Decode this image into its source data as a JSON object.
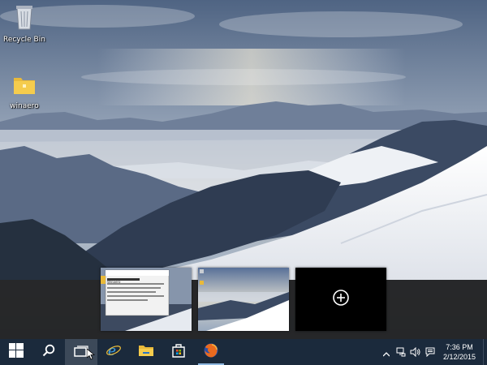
{
  "desktop": {
    "icons": [
      {
        "label": "Recycle Bin",
        "icon": "recycle-bin-icon"
      },
      {
        "label": "winaero",
        "icon": "folder-icon"
      }
    ]
  },
  "task_view": {
    "thumbnails": [
      {
        "name": "desktop-1",
        "window_title": "Winaero"
      },
      {
        "name": "desktop-2"
      }
    ],
    "new_desktop_icon": "plus-circle-icon"
  },
  "taskbar": {
    "buttons": [
      {
        "name": "start",
        "icon": "windows-logo-icon"
      },
      {
        "name": "search",
        "icon": "search-icon"
      },
      {
        "name": "task-view",
        "icon": "task-view-icon",
        "active": true
      },
      {
        "name": "internet-explorer",
        "icon": "internet-explorer-icon"
      },
      {
        "name": "file-explorer",
        "icon": "folder-icon"
      },
      {
        "name": "store",
        "icon": "store-icon"
      },
      {
        "name": "firefox",
        "icon": "firefox-icon",
        "running": true
      }
    ],
    "tray": {
      "icons": [
        "chevron-up-icon",
        "network-icon",
        "volume-icon",
        "action-center-icon"
      ],
      "time": "7:36 PM",
      "date": "2/12/2015"
    }
  },
  "colors": {
    "taskbar": "#1b2a3c",
    "taskview_band": "#1e1e1e",
    "accent": "#8fb8e0"
  }
}
